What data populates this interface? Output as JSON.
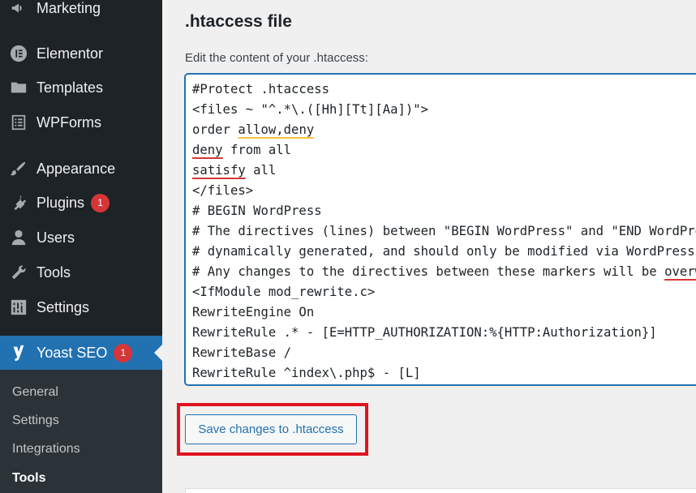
{
  "sidebar": {
    "items": [
      {
        "label": "Marketing",
        "icon": "megaphone-icon"
      },
      {
        "label": "Elementor",
        "icon": "elementor-icon"
      },
      {
        "label": "Templates",
        "icon": "folder-icon"
      },
      {
        "label": "WPForms",
        "icon": "wpforms-icon"
      },
      {
        "label": "Appearance",
        "icon": "paintbrush-icon"
      },
      {
        "label": "Plugins",
        "icon": "plug-icon",
        "badge": "1"
      },
      {
        "label": "Users",
        "icon": "user-icon"
      },
      {
        "label": "Tools",
        "icon": "wrench-icon"
      },
      {
        "label": "Settings",
        "icon": "sliders-icon"
      },
      {
        "label": "Yoast SEO",
        "icon": "yoast-icon",
        "badge": "1",
        "active": true
      }
    ],
    "submenu": [
      {
        "label": "General"
      },
      {
        "label": "Settings"
      },
      {
        "label": "Integrations"
      },
      {
        "label": "Tools",
        "current": true
      }
    ]
  },
  "main": {
    "heading": ".htaccess file",
    "edit_label": "Edit the content of your .htaccess:",
    "code_lines": [
      "#Protect .htaccess",
      "<files ~ \"^.*\\.([Hh][Tt][Aa])\">",
      "order allow,deny",
      "deny from all",
      "satisfy all",
      "</files>",
      "# BEGIN WordPress",
      "# The directives (lines) between \"BEGIN WordPress\" and \"END WordPress\" are",
      "# dynamically generated, and should only be modified via WordPress filters.",
      "# Any changes to the directives between these markers will be overwritten.",
      "<IfModule mod_rewrite.c>",
      "RewriteEngine On",
      "RewriteRule .* - [E=HTTP_AUTHORIZATION:%{HTTP:Authorization}]",
      "RewriteBase /",
      "RewriteRule ^index\\.php$ - [L]"
    ],
    "save_button": "Save changes to .htaccess"
  },
  "colors": {
    "sidebar_bg": "#1d2327",
    "active_bg": "#2271b1",
    "badge": "#d63638",
    "highlight": "#e0141e"
  }
}
